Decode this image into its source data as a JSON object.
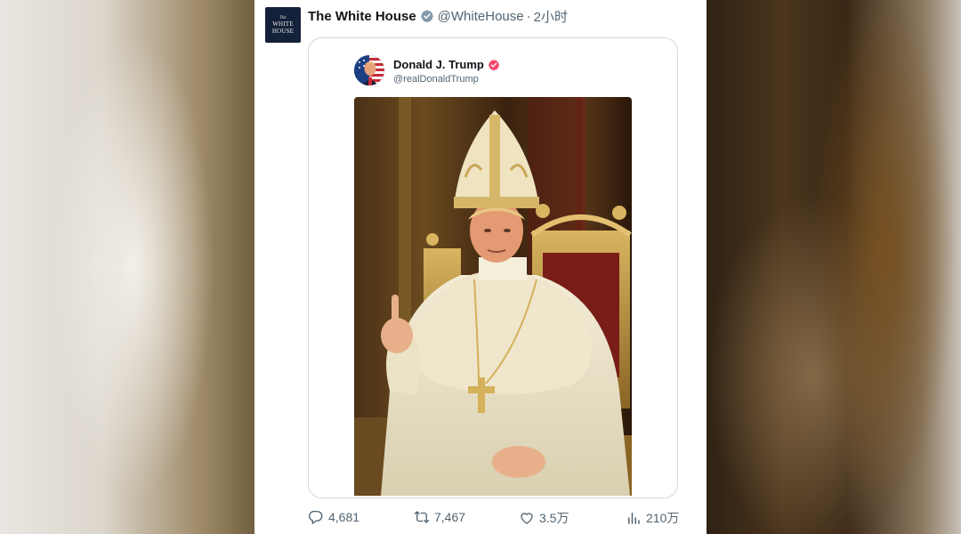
{
  "post": {
    "author_name": "The White House",
    "author_handle": "@WhiteHouse",
    "separator": "·",
    "time": "2小时",
    "avatar_text": [
      "The",
      "WHITE",
      "HOUSE"
    ],
    "verified_badge_color": "#829aab"
  },
  "quoted_post": {
    "author_name": "Donald J. Trump",
    "author_handle": "@realDonaldTrump",
    "verified_badge_color": "#f4456a",
    "image_icon": "pope-portrait-image"
  },
  "actions": {
    "replies": "4,681",
    "reposts": "7,467",
    "likes": "3.5万",
    "views": "210万",
    "icons": [
      "reply-icon",
      "repost-icon",
      "like-icon",
      "views-icon"
    ]
  },
  "colors": {
    "text_primary": "#0f1419",
    "text_secondary": "#536471",
    "border": "#cfd9de",
    "avatar_bg": "#14213a"
  }
}
